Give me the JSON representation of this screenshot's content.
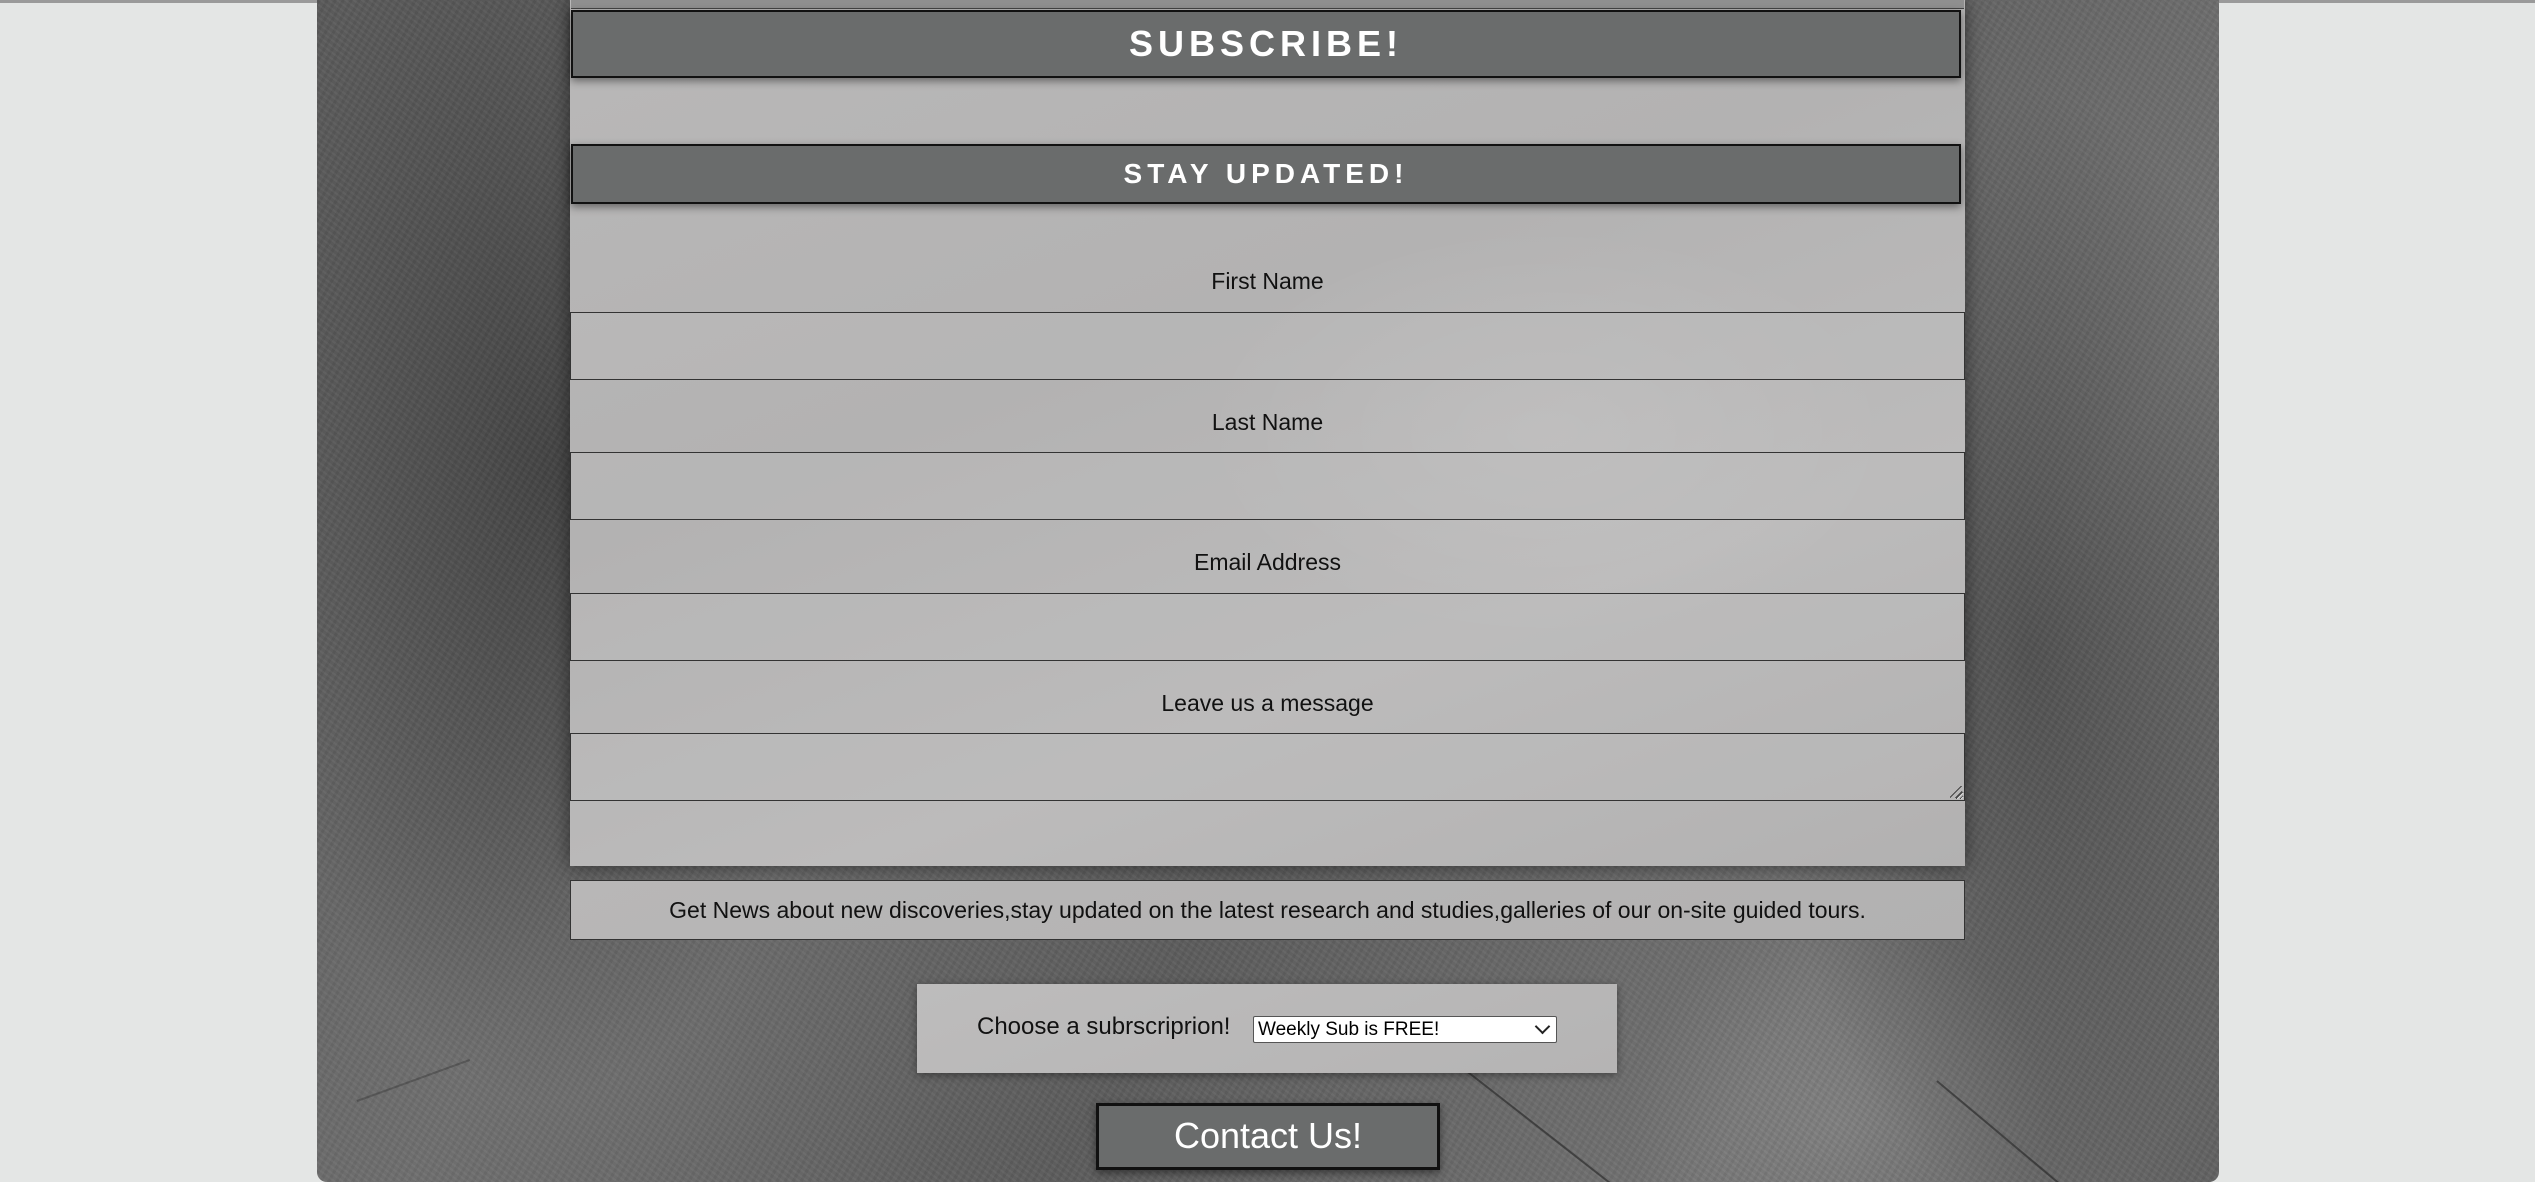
{
  "subscribe_header": "SUBSCRIBE!",
  "stay_header": "STAY UPDATED!",
  "form": {
    "first_name_label": "First Name",
    "first_name_value": "",
    "last_name_label": "Last Name",
    "last_name_value": "",
    "email_label": "Email Address",
    "email_value": "",
    "message_label": "Leave us a message",
    "message_value": ""
  },
  "news_text": "Get News about new discoveries,stay updated on the latest research and studies,galleries of our on-site guided tours.",
  "subscription": {
    "label": "Choose a subrscriprion!",
    "selected": "Weekly Sub is FREE!"
  },
  "contact_button": "Contact Us!",
  "colors": {
    "header_bg": "#6a6c6c",
    "page_bg": "#e4e6e5"
  },
  "icons": {
    "select_arrow": "chevron-down-icon",
    "textarea_grip": "resize-grip-icon"
  }
}
